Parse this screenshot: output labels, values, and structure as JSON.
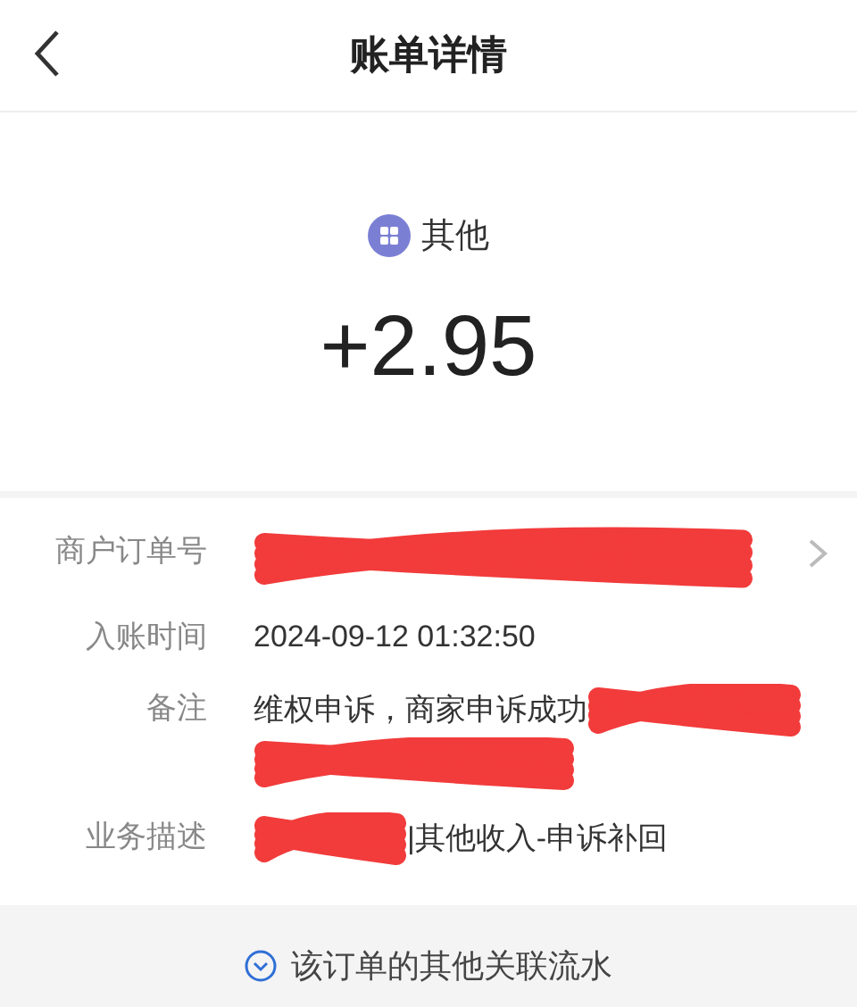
{
  "header": {
    "title": "账单详情"
  },
  "summary": {
    "category": "其他",
    "amount": "+2.95"
  },
  "rows": [
    {
      "label": "商户订单号",
      "kind": "masked",
      "chevron": true
    },
    {
      "label": "入账时间",
      "value": "2024-09-12 01:32:50",
      "kind": "plain",
      "chevron": false
    },
    {
      "label": "备注",
      "value": "维权申诉，商家申诉成功",
      "kind": "trailing_mask",
      "chevron": false
    },
    {
      "label": "业务描述",
      "value": "|其他收入-申诉补回",
      "kind": "leading_mask",
      "chevron": false
    }
  ],
  "footer": {
    "link": "该订单的其他关联流水"
  }
}
